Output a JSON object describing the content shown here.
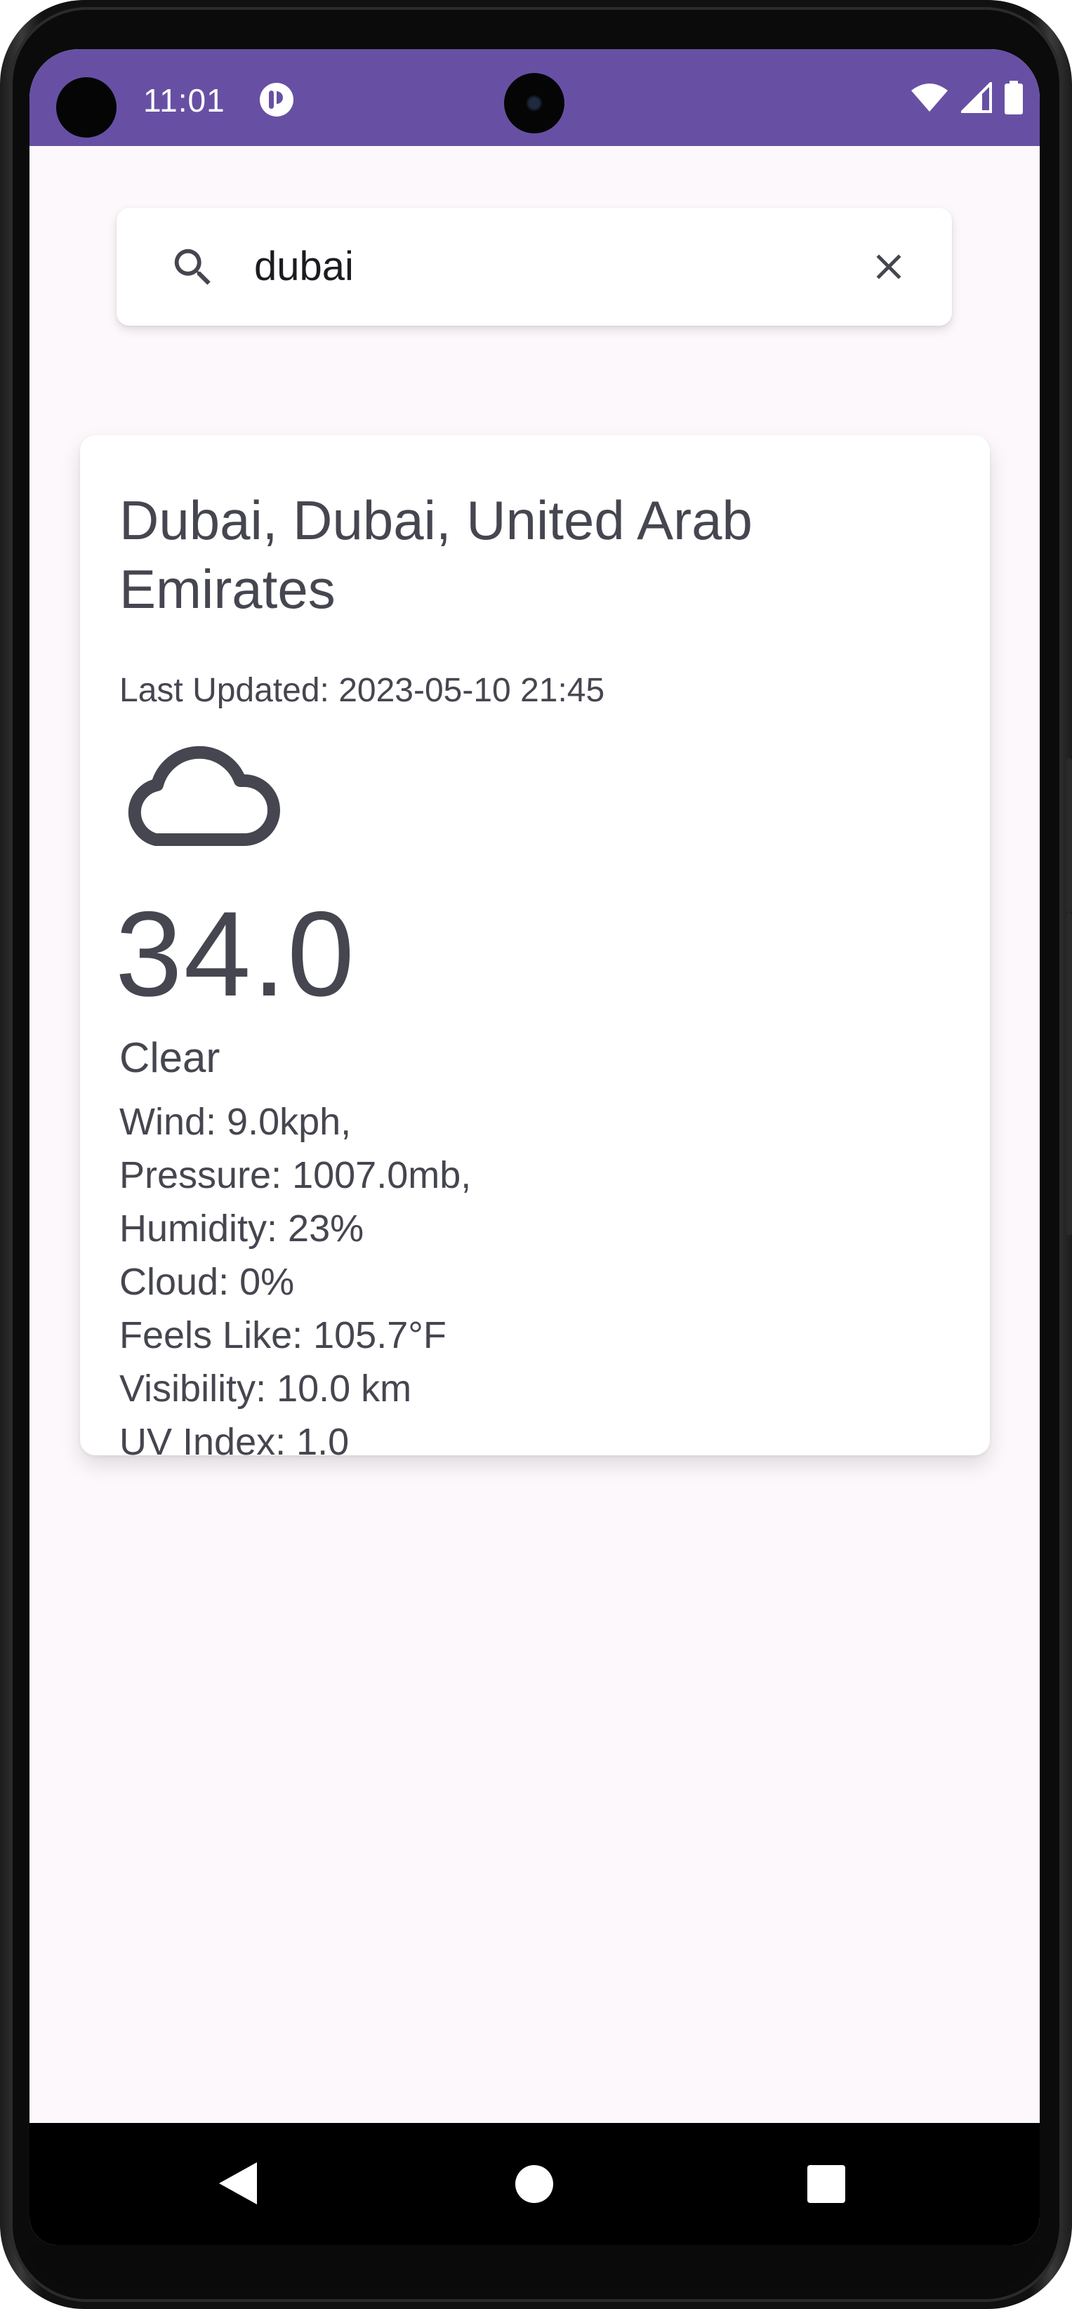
{
  "status_bar": {
    "time": "11:01",
    "background_color": "#6750a4",
    "icons": [
      "app-notification-icon",
      "wifi-icon",
      "cellular-signal-icon",
      "battery-icon"
    ]
  },
  "search": {
    "value": "dubai",
    "search_icon": "search-icon",
    "clear_icon": "close-icon"
  },
  "weather": {
    "location": "Dubai, Dubai, United Arab Emirates",
    "last_updated": "Last Updated: 2023-05-10 21:45",
    "icon": "cloud-icon",
    "temperature": "34.0",
    "condition": "Clear",
    "details": [
      "Wind: 9.0kph,",
      "Pressure: 1007.0mb,",
      "Humidity: 23%",
      "Cloud: 0%",
      "Feels Like: 105.7°F",
      "Visibility: 10.0 km",
      "UV Index: 1.0"
    ]
  },
  "nav_bar": {
    "buttons": [
      "back-icon",
      "home-icon",
      "recents-icon"
    ]
  }
}
